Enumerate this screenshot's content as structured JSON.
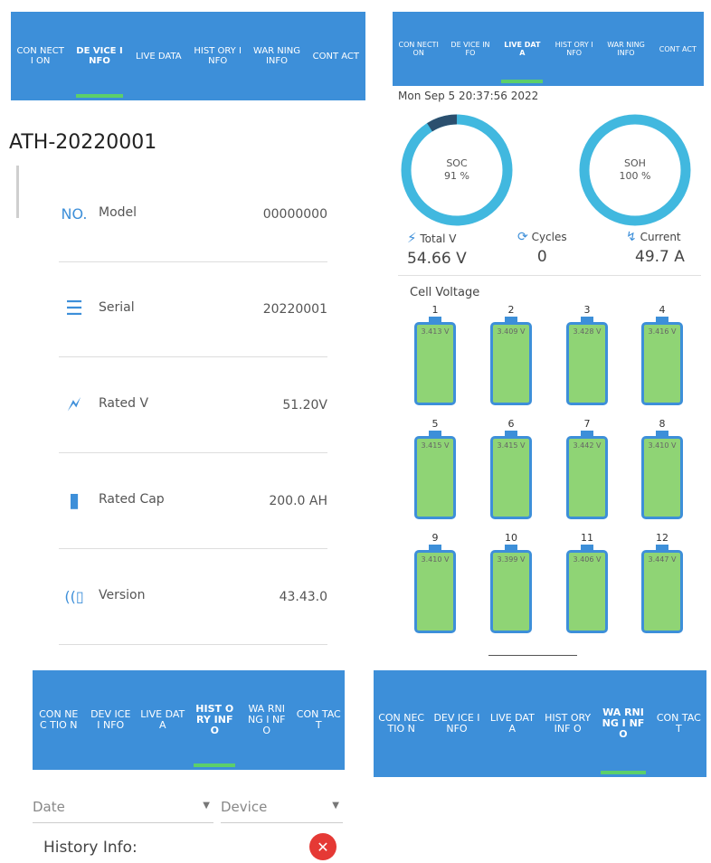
{
  "panel_device": {
    "tabs": [
      {
        "label": "CON NECTI ON",
        "active": false
      },
      {
        "label": "DE VICE INFO",
        "active": true
      },
      {
        "label": "LIVE DATA",
        "active": false
      },
      {
        "label": "HIST ORY INFO",
        "active": false
      },
      {
        "label": "WAR NING INFO",
        "active": false
      },
      {
        "label": "CONT ACT",
        "active": false
      }
    ],
    "device_name": "ATH-20220001",
    "rows": [
      {
        "icon": "number-icon",
        "glyph": "NO.",
        "label": "Model",
        "value": "00000000"
      },
      {
        "icon": "list-icon",
        "glyph": "☰",
        "label": "Serial",
        "value": "20220001"
      },
      {
        "icon": "battery-charging-icon",
        "glyph": "🗲",
        "label": "Rated V",
        "value": "51.20V"
      },
      {
        "icon": "battery-icon",
        "glyph": "▮",
        "label": "Rated Cap",
        "value": "200.0 AH"
      },
      {
        "icon": "version-icon",
        "glyph": "((▯",
        "label": "Version",
        "value": "43.43.0"
      }
    ]
  },
  "panel_live": {
    "tabs": [
      {
        "label": "CON NECTI ON",
        "active": false
      },
      {
        "label": "DE VICE INFO",
        "active": false
      },
      {
        "label": "LIVE DATA",
        "active": true
      },
      {
        "label": "HIST ORY INFO",
        "active": false
      },
      {
        "label": "WAR NING INFO",
        "active": false
      },
      {
        "label": "CONT ACT",
        "active": false
      }
    ],
    "timestamp": "Mon Sep  5 20:37:56 2022",
    "soc": {
      "label": "SOC",
      "value_text": "91 %",
      "fraction": 0.91
    },
    "soh": {
      "label": "SOH",
      "value_text": "100 %",
      "fraction": 1.0
    },
    "total_v": {
      "label": "Total V",
      "value": "54.66 V"
    },
    "cycles": {
      "label": "Cycles",
      "value": "0"
    },
    "current": {
      "label": "Current",
      "value": "49.7 A"
    },
    "cell_voltage_title": "Cell Voltage",
    "cells": [
      {
        "n": "1",
        "v": "3.413 V"
      },
      {
        "n": "2",
        "v": "3.409 V"
      },
      {
        "n": "3",
        "v": "3.428 V"
      },
      {
        "n": "4",
        "v": "3.416 V"
      },
      {
        "n": "5",
        "v": "3.415 V"
      },
      {
        "n": "6",
        "v": "3.415 V"
      },
      {
        "n": "7",
        "v": "3.442 V"
      },
      {
        "n": "8",
        "v": "3.410 V"
      },
      {
        "n": "9",
        "v": "3.410 V"
      },
      {
        "n": "10",
        "v": "3.399 V"
      },
      {
        "n": "11",
        "v": "3.406 V"
      },
      {
        "n": "12",
        "v": "3.447 V"
      }
    ],
    "accent": "#3d8fd9",
    "ring_color": "#41b8df",
    "soc_gap_color": "#2b4f6e"
  },
  "panel_history": {
    "tabs": [
      {
        "label": "CON NEC TIO N",
        "active": false
      },
      {
        "label": "DEV ICE I NFO",
        "active": false
      },
      {
        "label": "LIVE DAT A",
        "active": false
      },
      {
        "label": "HIST ORY INF O",
        "active": true
      },
      {
        "label": "WA RNI NG I NFO",
        "active": false
      },
      {
        "label": "CON TAC T",
        "active": false
      }
    ],
    "date_placeholder": "Date",
    "device_placeholder": "Device",
    "history_label": "History Info:"
  },
  "panel_warning": {
    "tabs": [
      {
        "label": "CON NEC TIO N",
        "active": false
      },
      {
        "label": "DEV ICE I NFO",
        "active": false
      },
      {
        "label": "LIVE DAT A",
        "active": false
      },
      {
        "label": "HIST ORY INF O",
        "active": false
      },
      {
        "label": "WA RNI NG I NFO",
        "active": true
      },
      {
        "label": "CON TAC T",
        "active": false
      }
    ]
  }
}
